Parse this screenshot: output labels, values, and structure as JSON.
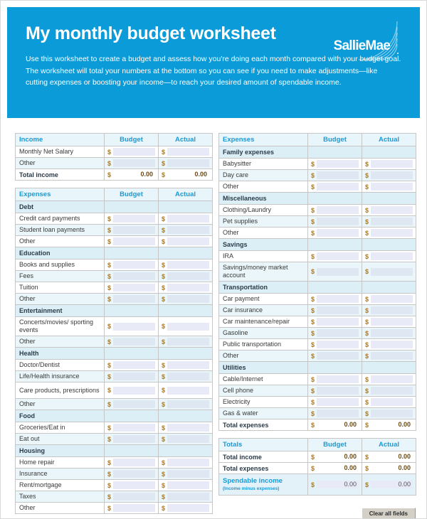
{
  "header": {
    "title": "My monthly budget worksheet",
    "description": "Use this worksheet to create a budget and assess how you're doing each month compared with your budget goal. The worksheet will total your numbers at the bottom so you can see if you need to make adjustments—like cutting expenses or boosting your income—to reach your desired amount of spendable income.",
    "logo_text": "SallieMae",
    "brand_color": "#0b9bd8"
  },
  "columns": {
    "budget": "Budget",
    "actual": "Actual"
  },
  "income_table": {
    "title": "Income",
    "rows": [
      {
        "label": "Monthly Net Salary",
        "type": "input"
      },
      {
        "label": "Other",
        "type": "input"
      }
    ],
    "total": {
      "label": "Total income",
      "budget": "0.00",
      "actual": "0.00"
    }
  },
  "left_expenses": {
    "title": "Expenses",
    "sections": [
      {
        "name": "Debt",
        "rows": [
          {
            "label": "Credit card payments"
          },
          {
            "label": "Student loan payments"
          },
          {
            "label": "Other"
          }
        ]
      },
      {
        "name": "Education",
        "rows": [
          {
            "label": "Books and supplies"
          },
          {
            "label": "Fees"
          },
          {
            "label": "Tuition"
          },
          {
            "label": "Other"
          }
        ]
      },
      {
        "name": "Entertainment",
        "rows": [
          {
            "label": "Concerts/movies/ sporting events",
            "tall": true
          },
          {
            "label": "Other"
          }
        ]
      },
      {
        "name": "Health",
        "rows": [
          {
            "label": "Doctor/Dentist"
          },
          {
            "label": "Life/Health insurance"
          },
          {
            "label": "Care products, prescriptions",
            "tall": true
          },
          {
            "label": "Other"
          }
        ]
      },
      {
        "name": "Food",
        "rows": [
          {
            "label": "Groceries/Eat in"
          },
          {
            "label": "Eat out"
          }
        ]
      },
      {
        "name": "Housing",
        "rows": [
          {
            "label": "Home repair"
          },
          {
            "label": "Insurance"
          },
          {
            "label": "Rent/mortgage"
          },
          {
            "label": "Taxes"
          },
          {
            "label": "Other"
          }
        ]
      }
    ]
  },
  "right_expenses": {
    "title": "Expenses",
    "sections": [
      {
        "name": "Family expenses",
        "rows": [
          {
            "label": "Babysitter"
          },
          {
            "label": "Day care"
          },
          {
            "label": "Other"
          }
        ]
      },
      {
        "name": "Miscellaneous",
        "rows": [
          {
            "label": "Clothing/Laundry"
          },
          {
            "label": "Pet supplies"
          },
          {
            "label": "Other"
          }
        ]
      },
      {
        "name": "Savings",
        "rows": [
          {
            "label": "IRA"
          },
          {
            "label": "Savings/money market account",
            "tall": true
          }
        ]
      },
      {
        "name": "Transportation",
        "rows": [
          {
            "label": "Car payment"
          },
          {
            "label": "Car insurance"
          },
          {
            "label": "Car maintenance/repair"
          },
          {
            "label": "Gasoline"
          },
          {
            "label": "Public transportation"
          },
          {
            "label": "Other"
          }
        ]
      },
      {
        "name": "Utilities",
        "rows": [
          {
            "label": "Cable/Internet"
          },
          {
            "label": "Cell phone"
          },
          {
            "label": "Electricity"
          },
          {
            "label": "Gas & water"
          }
        ]
      }
    ],
    "total": {
      "label": "Total expenses",
      "budget": "0.00",
      "actual": "0.00"
    }
  },
  "totals_table": {
    "title": "Totals",
    "rows": [
      {
        "label": "Total income",
        "budget": "0.00",
        "actual": "0.00"
      },
      {
        "label": "Total expenses",
        "budget": "0.00",
        "actual": "0.00"
      }
    ],
    "spendable": {
      "label": "Spendable income",
      "sublabel": "(Income minus expenses)",
      "budget": "0.00",
      "actual": "0.00"
    }
  },
  "clear_button": "Clear all fields",
  "currency_symbol": "$"
}
